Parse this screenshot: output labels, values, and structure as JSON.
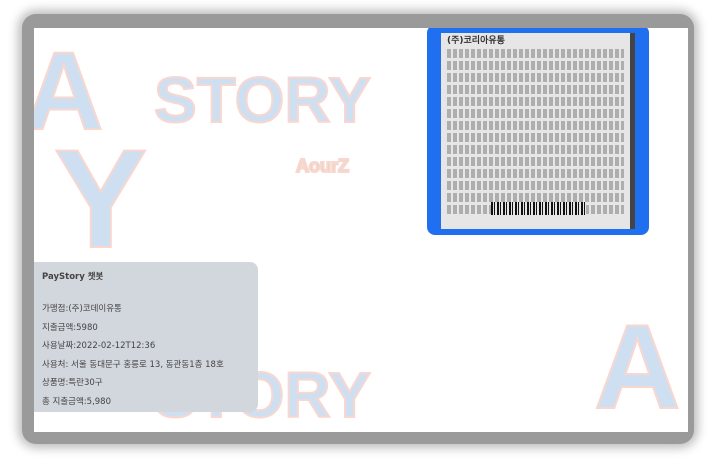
{
  "background": {
    "watermark_text": "STORY",
    "logo_text": "AourZ"
  },
  "receipt": {
    "header": "(주)코리아유통"
  },
  "chat": {
    "title": "PayStory 챗봇",
    "lines": [
      "가맹점:(주)코데이유통",
      "지출금액:5980",
      "사용날짜:2022-02-12T12:36",
      "사용처: 서울 동대문구 홍릉로 13, 동관동1층 18호",
      "상품명:특란30구",
      "총 지출금액:5,980"
    ]
  },
  "colors": {
    "receipt_border": "#1f6ff0",
    "bubble": "#d2d6dd"
  }
}
